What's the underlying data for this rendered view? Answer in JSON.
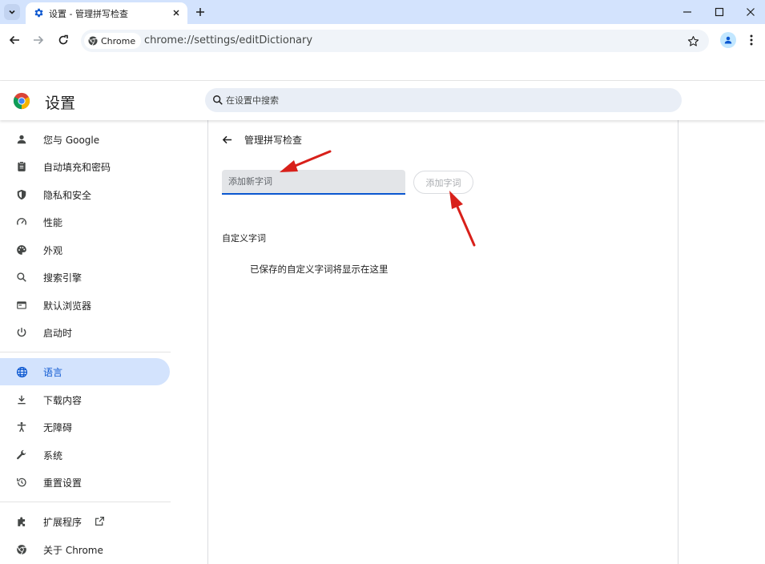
{
  "colors": {
    "tab_strip": "#d3e3fd",
    "accent": "#0b57d0",
    "active_nav_bg": "#d3e3fd",
    "annotation_arrow": "#d8201a"
  },
  "browser": {
    "tab": {
      "title": "设置 - 管理拼写检查",
      "favicon": "gear-icon"
    },
    "omnibox": {
      "chip_label": "Chrome",
      "url": "chrome://settings/editDictionary"
    }
  },
  "settings": {
    "title": "设置",
    "search_placeholder": "在设置中搜索"
  },
  "sidebar": {
    "items": [
      {
        "label": "您与 Google",
        "icon": "person-icon"
      },
      {
        "label": "自动填充和密码",
        "icon": "clipboard-icon"
      },
      {
        "label": "隐私和安全",
        "icon": "shield-icon"
      },
      {
        "label": "性能",
        "icon": "speedometer-icon"
      },
      {
        "label": "外观",
        "icon": "palette-icon"
      },
      {
        "label": "搜索引擎",
        "icon": "search-icon"
      },
      {
        "label": "默认浏览器",
        "icon": "browser-window-icon"
      },
      {
        "label": "启动时",
        "icon": "power-icon"
      },
      {
        "label": "语言",
        "icon": "globe-icon",
        "active": true
      },
      {
        "label": "下载内容",
        "icon": "download-icon"
      },
      {
        "label": "无障碍",
        "icon": "accessibility-icon"
      },
      {
        "label": "系统",
        "icon": "wrench-icon"
      },
      {
        "label": "重置设置",
        "icon": "history-icon"
      },
      {
        "label": "扩展程序",
        "icon": "puzzle-icon"
      },
      {
        "label": "关于 Chrome",
        "icon": "chrome-icon"
      }
    ]
  },
  "page": {
    "title": "管理拼写检查",
    "input_placeholder": "添加新字词",
    "add_button_label": "添加字词",
    "section_label": "自定义字词",
    "empty_message": "已保存的自定义字词将显示在这里"
  }
}
